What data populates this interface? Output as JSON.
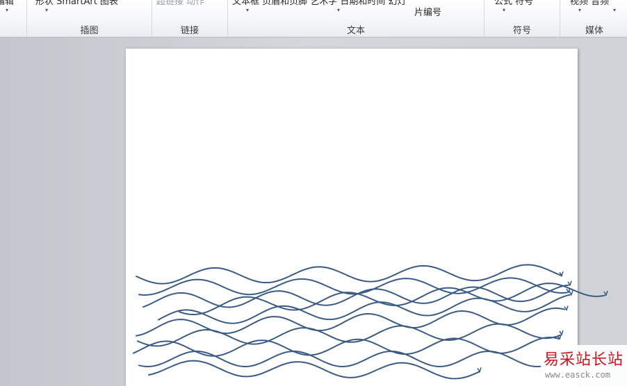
{
  "ribbon": {
    "cut_items": {
      "item1": "编辑",
      "item2": "形状 SmartArt 图表",
      "item3": "超链接 动作",
      "item4": "文本框 页眉和页脚 艺术字 日期和时间 幻灯",
      "item4_line2": "片编号",
      "item5": "公式 符号",
      "item6": "视频 音频"
    },
    "groups": {
      "illustrations": "插图",
      "links": "链接",
      "text": "文本",
      "symbols": "符号",
      "media": "媒体"
    }
  },
  "watermark": {
    "title": "易采站长站",
    "url": "www.easck.com"
  },
  "colors": {
    "wave_stroke": "#3a5a86",
    "watermark_red": "#c4161c"
  }
}
